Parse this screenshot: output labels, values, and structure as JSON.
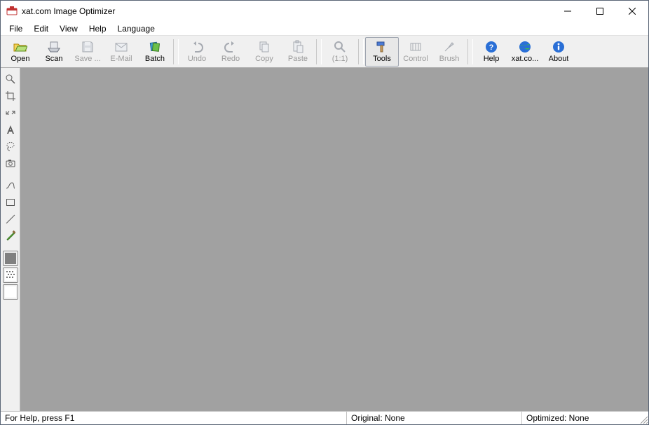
{
  "title": "xat.com  Image Optimizer",
  "menu": {
    "file": "File",
    "edit": "Edit",
    "view": "View",
    "help": "Help",
    "language": "Language"
  },
  "toolbar": {
    "open": "Open",
    "scan": "Scan",
    "save": "Save ...",
    "email": "E-Mail",
    "batch": "Batch",
    "undo": "Undo",
    "redo": "Redo",
    "copy": "Copy",
    "paste": "Paste",
    "zoom11": "(1:1)",
    "tools": "Tools",
    "control": "Control",
    "brush": "Brush",
    "help": "Help",
    "xatcom": "xat.co...",
    "about": "About"
  },
  "side": {
    "zoom": "zoom",
    "crop": "crop",
    "resize": "resize",
    "text": "text",
    "lasso": "lasso",
    "camera": "camera",
    "curve": "curve",
    "rect": "rect",
    "line": "line",
    "paint": "paint",
    "fgcolor": "#808080",
    "fgpattern": "pattern",
    "bgcolor": "#ffffff"
  },
  "status": {
    "help": "For Help, press F1",
    "original": "Original: None",
    "optimized": "Optimized: None"
  }
}
